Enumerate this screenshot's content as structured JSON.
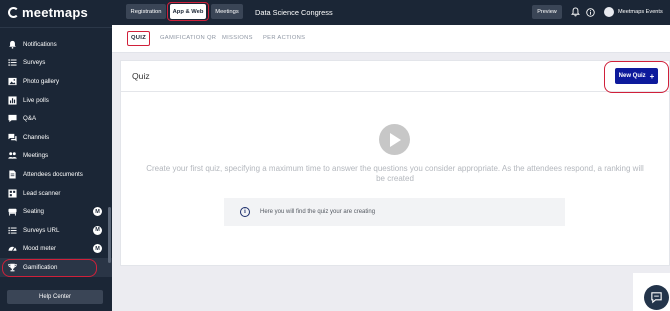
{
  "logo": {
    "text": "meetmaps"
  },
  "sidebar": {
    "items": [
      {
        "label": "Notifications",
        "icon": "bell-icon"
      },
      {
        "label": "Surveys",
        "icon": "list-icon"
      },
      {
        "label": "Photo gallery",
        "icon": "image-icon"
      },
      {
        "label": "Live polls",
        "icon": "poll-icon"
      },
      {
        "label": "Q&A",
        "icon": "chat-bubble-icon"
      },
      {
        "label": "Channels",
        "icon": "channels-icon"
      },
      {
        "label": "Meetings",
        "icon": "meeting-icon"
      },
      {
        "label": "Attendees documents",
        "icon": "document-icon"
      },
      {
        "label": "Lead scanner",
        "icon": "scanner-icon"
      },
      {
        "label": "Seating",
        "icon": "seat-icon",
        "badge": "M"
      },
      {
        "label": "Surveys URL",
        "icon": "list-icon",
        "badge": "M"
      },
      {
        "label": "Mood meter",
        "icon": "gauge-icon",
        "badge": "M"
      },
      {
        "label": "Gamification",
        "icon": "trophy-icon",
        "active": true
      }
    ],
    "help_center": "Help Center"
  },
  "topbar": {
    "tabs": [
      {
        "label": "Registration"
      },
      {
        "label": "App & Web",
        "active": true
      },
      {
        "label": "Meetings"
      }
    ],
    "event_name": "Data Science Congress",
    "preview": "Preview",
    "user_name": "Meetmaps Events"
  },
  "subtabs": [
    {
      "label": "QUIZ",
      "active": true
    },
    {
      "label": "GAMIFICATION QR"
    },
    {
      "label": "MISSIONS"
    },
    {
      "label": "PER ACTIONS"
    }
  ],
  "main": {
    "title": "Quiz",
    "new_button": "New Quiz",
    "new_button_icon": "+",
    "description": "Create your first quiz, specifying a maximum time to answer the questions you consider appropriate. As the attendees respond, a ranking will be created",
    "info_text": "Here you will find the quiz your are creating"
  },
  "colors": {
    "sidebar_bg": "#1b2636",
    "accent_blue": "#0d1a9c",
    "highlight_red": "#d0203a"
  }
}
